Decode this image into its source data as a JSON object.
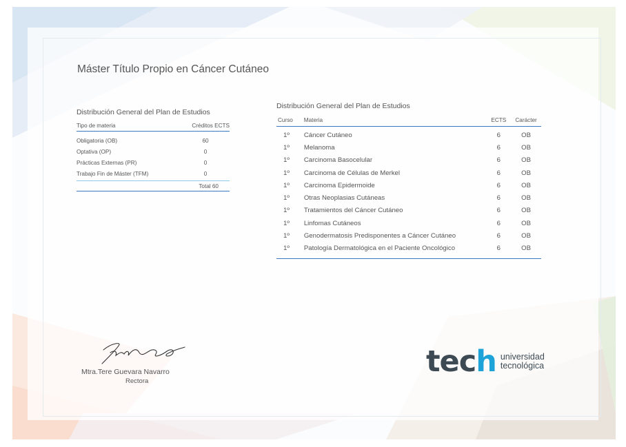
{
  "document": {
    "title": "Máster Título Propio en Cáncer Cutáneo"
  },
  "summary_table": {
    "title": "Distribución General del Plan de Estudios",
    "headers": {
      "type": "Tipo de materia",
      "credits": "Créditos ECTS"
    },
    "rows": [
      {
        "type": "Obligatoria (OB)",
        "credits": "60"
      },
      {
        "type": "Optativa (OP)",
        "credits": "0"
      },
      {
        "type": "Prácticas Externas (PR)",
        "credits": "0"
      },
      {
        "type": "Trabajo Fin de Máster (TFM)",
        "credits": "0"
      }
    ],
    "total": "Total 60"
  },
  "detail_table": {
    "title": "Distribución General del Plan de Estudios",
    "headers": {
      "course": "Curso",
      "subject": "Materia",
      "ects": "ECTS",
      "character": "Carácter"
    },
    "rows": [
      {
        "course": "1º",
        "subject": "Cáncer Cutáneo",
        "ects": "6",
        "character": "OB"
      },
      {
        "course": "1º",
        "subject": "Melanoma",
        "ects": "6",
        "character": "OB"
      },
      {
        "course": "1º",
        "subject": "Carcinoma Basocelular",
        "ects": "6",
        "character": "OB"
      },
      {
        "course": "1º",
        "subject": "Carcinoma de Células de Merkel",
        "ects": "6",
        "character": "OB"
      },
      {
        "course": "1º",
        "subject": "Carcinoma Epidermoide",
        "ects": "6",
        "character": "OB"
      },
      {
        "course": "1º",
        "subject": "Otras Neoplasias Cutáneas",
        "ects": "6",
        "character": "OB"
      },
      {
        "course": "1º",
        "subject": "Tratamientos del Cáncer Cutáneo",
        "ects": "6",
        "character": "OB"
      },
      {
        "course": "1º",
        "subject": "Linfomas Cutáneos",
        "ects": "6",
        "character": "OB"
      },
      {
        "course": "1º",
        "subject": "Genodermatosis Predisponentes a Cáncer Cutáneo",
        "ects": "6",
        "character": "OB"
      },
      {
        "course": "1º",
        "subject": "Patología Dermatológica en el Paciente Oncológico",
        "ects": "6",
        "character": "OB"
      }
    ]
  },
  "signatory": {
    "name": "Mtra.Tere Guevara Navarro",
    "role": "Rectora"
  },
  "logo": {
    "word_prefix": "tec",
    "word_suffix": "h",
    "line1": "universidad",
    "line2": "tecnológica"
  },
  "colors": {
    "accent_blue": "#3b78c4",
    "light_blue": "#8ec9ea",
    "logo_cyan": "#1ea3d9",
    "logo_dark": "#3d4a54"
  }
}
